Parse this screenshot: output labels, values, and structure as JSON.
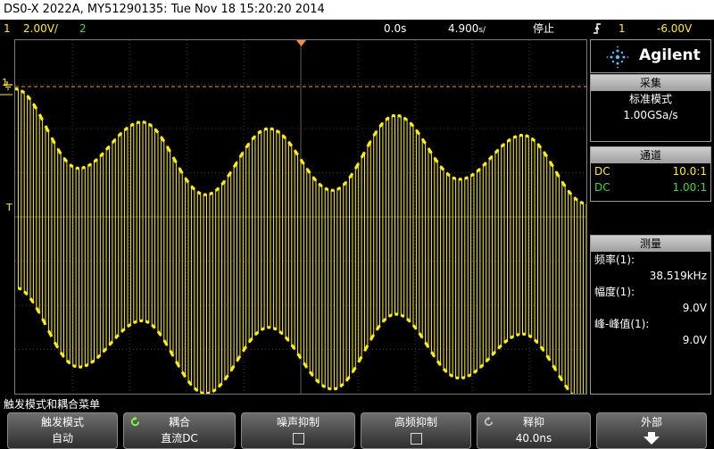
{
  "title": "DS0-X 2022A, MY51290135: Tue Nov 18 15:20:20 2014",
  "status": {
    "ch1_num": "1",
    "ch1_scale": "2.00V/",
    "ch2_num": "2",
    "time_delay": "0.0s",
    "time_scale": "4.900",
    "time_unit": "s/",
    "run_state": "停止",
    "trigger_ch": "1",
    "trigger_level": "-6.00V"
  },
  "markers": {
    "ch1": "1",
    "trigger": "T"
  },
  "waveform": {
    "ch1_color": "#ffef00",
    "ch1_range_v": [
      -8,
      8
    ],
    "time_range_ms": [
      -2.45,
      2.45
    ],
    "high_v": [
      5.8,
      2.2,
      4.3,
      1.0,
      4.0,
      1.2,
      4.6,
      1.7,
      3.7,
      0.6
    ],
    "low_v": [
      -3.2,
      -6.8,
      -4.7,
      -8.0,
      -5.0,
      -7.8,
      -4.4,
      -7.3,
      -5.3,
      -8.4
    ],
    "cursor_color": "#ff8c3a",
    "cursor_high_v": 5.9,
    "cursor_low_v": -9.0
  },
  "brand": {
    "name": "Agilent",
    "logo_icon": "agilent-spark-icon"
  },
  "acquire": {
    "header": "采集",
    "mode": "标准模式",
    "rate": "1.00GSa/s"
  },
  "channels": {
    "header": "通道",
    "ch1_coupling": "DC",
    "ch1_probe": "10.0:1",
    "ch2_coupling": "DC",
    "ch2_probe": "1.00:1"
  },
  "measure": {
    "header": "测量",
    "freq_label": "频率(1):",
    "freq_value": "38.519kHz",
    "amp_label": "幅度(1):",
    "amp_value": "9.0V",
    "pkpk_label": "峰-峰值(1):",
    "pkpk_value": "9.0V"
  },
  "softkey_title": "触发模式和耦合菜单",
  "softkeys": {
    "mode_label": "触发模式",
    "mode_value": "自动",
    "coupling_label": "耦合",
    "coupling_value": "直流DC",
    "noise_label": "噪声抑制",
    "hf_label": "高频抑制",
    "holdoff_label": "释抑",
    "holdoff_value": "40.0ns",
    "external_label": "外部"
  }
}
